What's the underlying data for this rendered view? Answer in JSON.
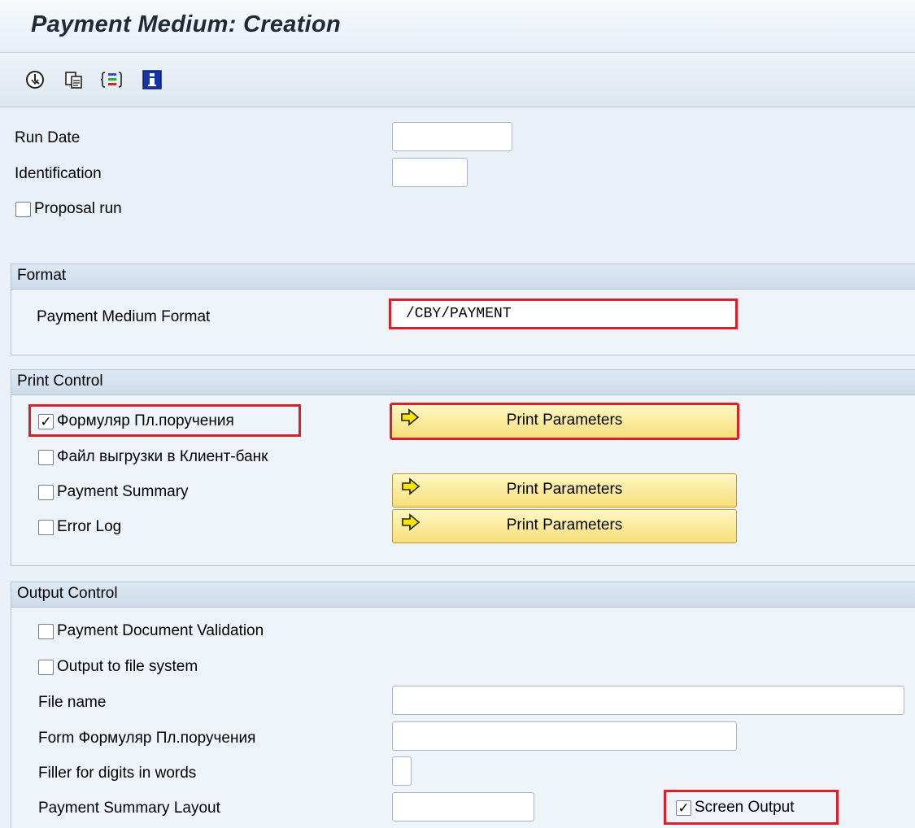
{
  "window": {
    "title": "Payment Medium: Creation"
  },
  "toolbar": {
    "icons": [
      "execute-icon",
      "variant-icon",
      "selection-options-icon",
      "info-icon"
    ]
  },
  "selection": {
    "run_date": {
      "label": "Run Date",
      "value": ""
    },
    "identification": {
      "label": "Identification",
      "value": ""
    },
    "proposal_run": {
      "label": "Proposal run",
      "checked": false
    }
  },
  "format": {
    "header": "Format",
    "payment_medium_format": {
      "label": "Payment Medium Format",
      "value": "/CBY/PAYMENT"
    }
  },
  "print_control": {
    "header": "Print Control",
    "form_payment_order": {
      "label": "Формуляр Пл.поручения",
      "checked": true
    },
    "client_bank_file": {
      "label": "Файл выгрузки в Клиент-банк",
      "checked": false
    },
    "payment_summary": {
      "label": "Payment Summary",
      "checked": false
    },
    "error_log": {
      "label": "Error Log",
      "checked": false
    },
    "print_parameters_label": "Print Parameters"
  },
  "output_control": {
    "header": "Output Control",
    "payment_document_validation": {
      "label": "Payment Document Validation",
      "checked": false
    },
    "output_to_file_system": {
      "label": "Output to file system",
      "checked": false
    },
    "file_name": {
      "label": "File name",
      "value": ""
    },
    "form_name": {
      "label": "Form Формуляр Пл.поручения",
      "value": ""
    },
    "filler_digits": {
      "label": "Filler for digits in words",
      "value": ""
    },
    "payment_summary_layout": {
      "label": "Payment Summary Layout",
      "value": ""
    },
    "screen_output": {
      "label": "Screen Output",
      "checked": true
    }
  },
  "colors": {
    "highlight": "#d9212b",
    "button_fill": "#f7df7a",
    "background": "#e9f0f7"
  }
}
